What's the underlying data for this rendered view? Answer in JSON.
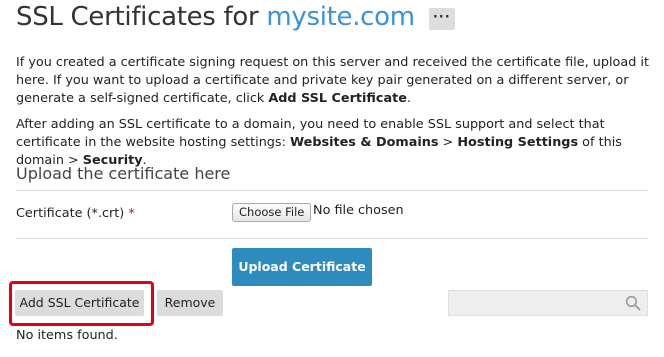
{
  "header": {
    "title_prefix": "SSL Certificates for",
    "domain": "mysite.com",
    "more_label": "···"
  },
  "intro": {
    "p1_text": "If you created a certificate signing request on this server and received the certificate file, upload it here. If you want to upload a certificate and private key pair generated on a different server, or generate a self-signed certificate, click ",
    "p1_bold": "Add SSL Certificate",
    "p1_end": ".",
    "p2_text1": "After adding an SSL certificate to a domain, you need to enable SSL support and select that certificate in the website hosting settings: ",
    "p2_bold1": "Websites & Domains",
    "p2_sep1": " > ",
    "p2_bold2": "Hosting Settings",
    "p2_text2": " of this domain > ",
    "p2_bold3": "Security",
    "p2_end": "."
  },
  "upload": {
    "section_title": "Upload the certificate here",
    "field_label": "Certificate (*.crt)",
    "required_mark": "*",
    "choose_file_label": "Choose File",
    "no_file_text": "No file chosen",
    "upload_button_label": "Upload Certificate"
  },
  "toolbar": {
    "add_label": "Add SSL Certificate",
    "remove_label": "Remove",
    "search_placeholder": "",
    "highlight_color": "#e0001a"
  },
  "list": {
    "empty_text": "No items found."
  },
  "colors": {
    "domain": "#3a93d8",
    "primary_button": "#2e8bbd",
    "required": "#d0021b"
  },
  "icons": {
    "search": "search-icon",
    "more": "more-icon"
  }
}
